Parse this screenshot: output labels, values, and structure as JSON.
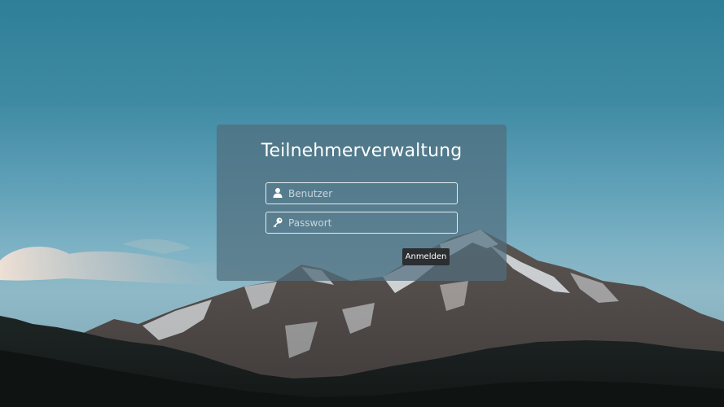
{
  "login": {
    "title": "Teilnehmerverwaltung",
    "username": {
      "placeholder": "Benutzer",
      "value": "",
      "icon": "user-icon"
    },
    "password": {
      "placeholder": "Passwort",
      "value": "",
      "icon": "key-icon"
    },
    "submit_label": "Anmelden"
  },
  "background": {
    "description_icon": "mountain-landscape-background"
  },
  "colors": {
    "card": "#506e7d",
    "button": "#2b2f31",
    "text": "#ffffff",
    "sky_top": "#2f7f98",
    "sky_mid": "#7fb3c5"
  }
}
